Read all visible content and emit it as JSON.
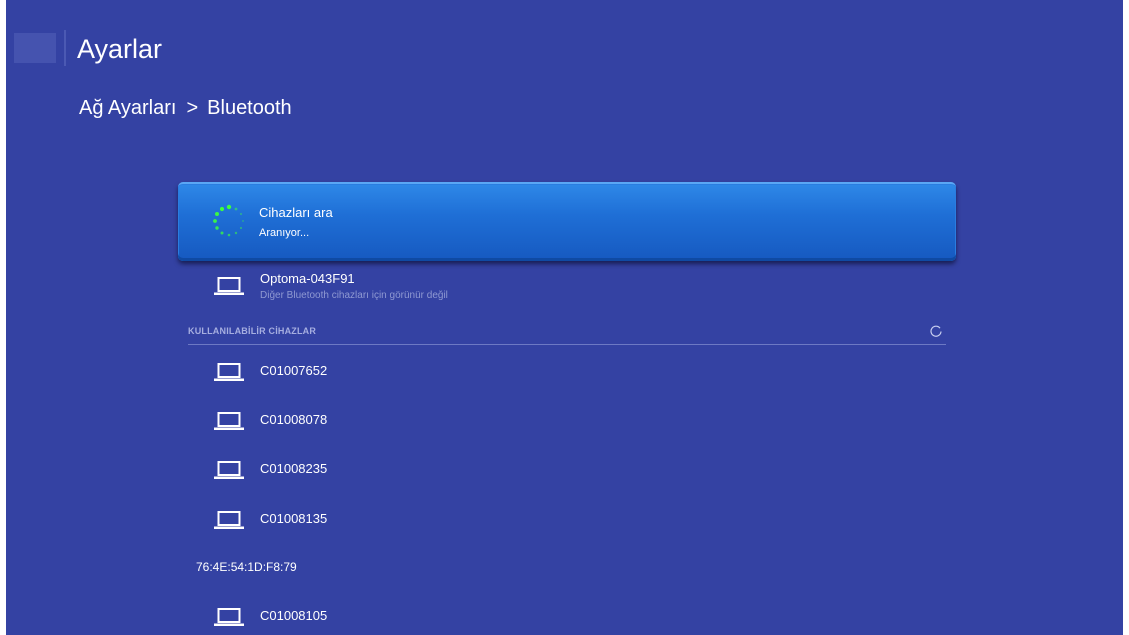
{
  "header": {
    "title": "Ayarlar",
    "logo_icon": "app-logo-icon"
  },
  "breadcrumb": {
    "parent": "Ağ Ayarları",
    "separator": ">",
    "current": "Bluetooth"
  },
  "scan": {
    "title": "Cihazları ara",
    "status": "Aranıyor...",
    "icon": "loading-spinner-icon",
    "colors": {
      "highlight": "#1f6fd6",
      "spinner": "#3cff3c"
    }
  },
  "own_device": {
    "name": "Optoma-043F91",
    "subtitle": "Diğer Bluetooth cihazları için görünür değil",
    "icon": "laptop-icon"
  },
  "available": {
    "header": "KULLANILABİLİR CİHAZLAR",
    "refresh_icon": "refresh-icon",
    "devices": [
      {
        "name": "C01007652",
        "icon": "laptop-icon"
      },
      {
        "name": "C01008078",
        "icon": "laptop-icon"
      },
      {
        "name": "C01008235",
        "icon": "laptop-icon"
      },
      {
        "name": "C01008135",
        "icon": "laptop-icon"
      },
      {
        "name": "76:4E:54:1D:F8:79",
        "icon": ""
      },
      {
        "name": "C01008105",
        "icon": "laptop-icon"
      }
    ]
  },
  "theme": {
    "background": "#3442a3",
    "text": "#ffffff",
    "muted_text": "#8f99d2"
  }
}
